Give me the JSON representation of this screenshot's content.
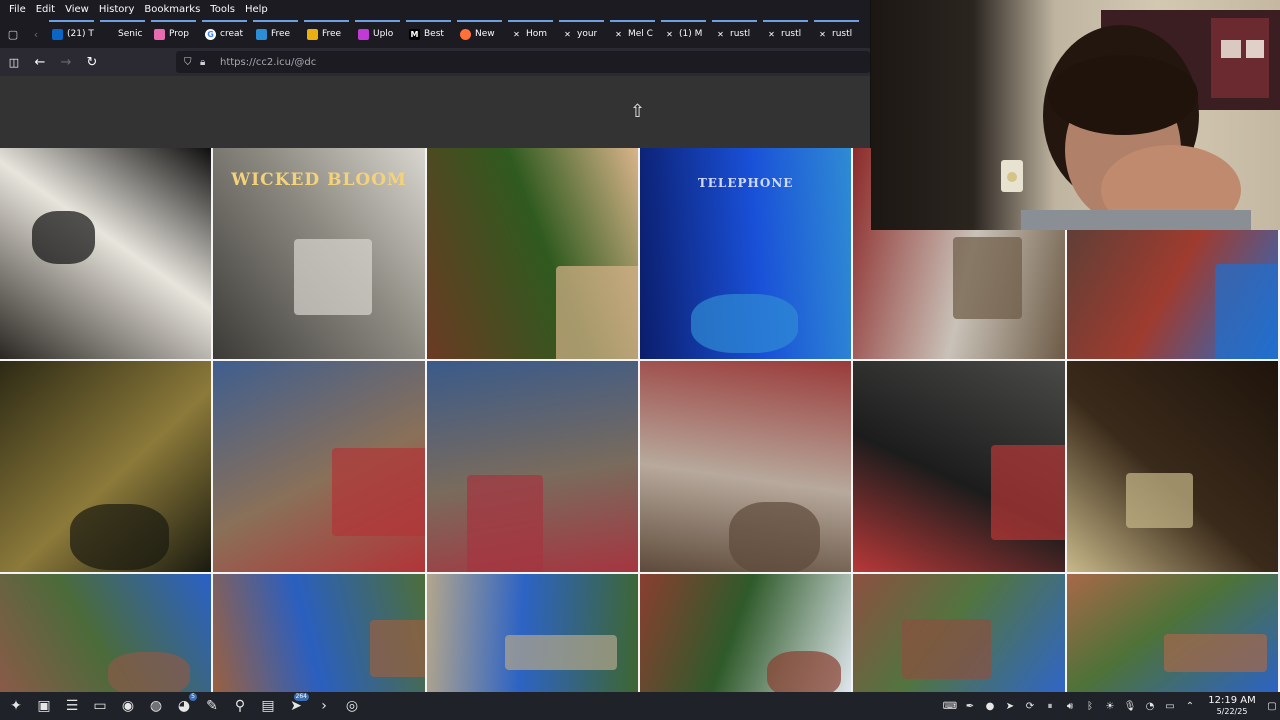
{
  "menu": [
    "File",
    "Edit",
    "View",
    "History",
    "Bookmarks",
    "Tools",
    "Help"
  ],
  "tabs": [
    {
      "label": "(21) T",
      "icon": "linkedin-icon",
      "color": "#0a66c2"
    },
    {
      "label": "Senic",
      "icon": "blank-page-icon",
      "color": "#3a3944"
    },
    {
      "label": "Prop",
      "icon": "ghost-icon",
      "color": "#e86ab0"
    },
    {
      "label": "creat",
      "icon": "google-icon",
      "color": "#ffffff"
    },
    {
      "label": "Free",
      "icon": "edge-icon",
      "color": "#2b8dd6"
    },
    {
      "label": "Free",
      "icon": "colorful-square-icon",
      "color": "#e9b10f"
    },
    {
      "label": "Uplo",
      "icon": "colorful-square-icon",
      "color": "#c23ad6"
    },
    {
      "label": "Best",
      "icon": "medium-icon",
      "color": "#000000"
    },
    {
      "label": "New",
      "icon": "firefox-icon",
      "color": "#ff7139"
    },
    {
      "label": "Hom",
      "icon": "x-icon",
      "color": "#000000"
    },
    {
      "label": "your",
      "icon": "x-icon",
      "color": "#000000"
    },
    {
      "label": "Mel C",
      "icon": "x-icon",
      "color": "#000000"
    },
    {
      "label": "(1) M",
      "icon": "x-icon",
      "color": "#000000"
    },
    {
      "label": "rustl",
      "icon": "x-icon",
      "color": "#000000"
    },
    {
      "label": "rustl",
      "icon": "x-icon",
      "color": "#000000"
    },
    {
      "label": "rustl",
      "icon": "x-icon",
      "color": "#000000"
    }
  ],
  "url": "https://cc2.icu/@dc",
  "photos": [
    {
      "name": "photo-vintage-camera",
      "colors": [
        "#2a2621",
        "#e8e5dd",
        "#0f0f0f"
      ]
    },
    {
      "name": "photo-wicked-bloom-storefront",
      "caption": "WICKED BLOOM",
      "colors": [
        "#3b3a36",
        "#8b8880",
        "#d9d6cf"
      ]
    },
    {
      "name": "photo-gingerbread-garden",
      "colors": [
        "#6b3a22",
        "#2f5a1f",
        "#d9b48a"
      ]
    },
    {
      "name": "photo-telephone-blue-light",
      "caption": "TELEPHONE",
      "colors": [
        "#0b1d6b",
        "#1950d8",
        "#2f8bd4"
      ]
    },
    {
      "name": "photo-construction-red-wall-1",
      "colors": [
        "#8c2a2a",
        "#c9c2b8",
        "#6c5a45"
      ]
    },
    {
      "name": "photo-construction-blue-tarp-1",
      "colors": [
        "#4a4039",
        "#9f3b2f",
        "#1f6fcf"
      ]
    },
    {
      "name": "photo-night-excavation-1",
      "colors": [
        "#2d2a15",
        "#8c7a3a",
        "#1a1a10"
      ]
    },
    {
      "name": "photo-blue-tarp-excavation-1",
      "colors": [
        "#3f5e8f",
        "#8a7058",
        "#b23438"
      ]
    },
    {
      "name": "photo-blue-tarp-excavation-2",
      "colors": [
        "#3a5a8a",
        "#7a6b5c",
        "#a53540"
      ]
    },
    {
      "name": "photo-excavation-red-wall",
      "colors": [
        "#9a3a3a",
        "#b7a99c",
        "#5e4a3a"
      ]
    },
    {
      "name": "photo-concrete-foundation",
      "colors": [
        "#4a4a48",
        "#1c1c1c",
        "#b83838"
      ]
    },
    {
      "name": "photo-night-foundation",
      "colors": [
        "#1f140c",
        "#3a2a1a",
        "#c8b98a"
      ]
    },
    {
      "name": "photo-backyard-tarp-1",
      "colors": [
        "#2a60c8",
        "#4b6b3a",
        "#8a5a48"
      ]
    },
    {
      "name": "photo-backyard-tarp-2",
      "colors": [
        "#4d6e3a",
        "#2a5fc0",
        "#9a6040"
      ]
    },
    {
      "name": "photo-backyard-tarp-3",
      "colors": [
        "#3e6630",
        "#2d63c4",
        "#b3a68c"
      ]
    },
    {
      "name": "photo-trees-brick-building",
      "colors": [
        "#dfe6ec",
        "#2f5a2a",
        "#8a3e30"
      ]
    },
    {
      "name": "photo-backyard-tarp-4",
      "colors": [
        "#2f66c8",
        "#52743f",
        "#8c5040"
      ]
    },
    {
      "name": "photo-backyard-tarp-5",
      "colors": [
        "#2c63c4",
        "#4e7238",
        "#a86848"
      ]
    }
  ],
  "taskbar": {
    "apps": [
      {
        "name": "app-launcher-icon",
        "glyph": "✦"
      },
      {
        "name": "package-store-icon",
        "glyph": "▣"
      },
      {
        "name": "settings-panel-icon",
        "glyph": "☰"
      },
      {
        "name": "file-manager-icon",
        "glyph": "▭"
      },
      {
        "name": "firefox-icon",
        "glyph": "◉"
      },
      {
        "name": "web-browser-icon",
        "glyph": "◍"
      },
      {
        "name": "discord-icon",
        "glyph": "◕",
        "badge": "5"
      },
      {
        "name": "text-editor-icon",
        "glyph": "✎"
      },
      {
        "name": "magnifier-icon",
        "glyph": "⚲"
      },
      {
        "name": "notes-icon",
        "glyph": "▤"
      },
      {
        "name": "telegram-icon",
        "glyph": "➤",
        "badge": "264"
      },
      {
        "name": "terminal-icon",
        "glyph": "›"
      },
      {
        "name": "obs-icon",
        "glyph": "◎"
      }
    ],
    "tray": [
      "keyboard-icon",
      "pen-icon",
      "obs-tray-icon",
      "telegram-tray-icon",
      "update-icon",
      "pause-icon",
      "volume-icon",
      "bluetooth-icon",
      "brightness-icon",
      "microphone-icon",
      "network-icon",
      "battery-icon",
      "chevron-up-icon"
    ],
    "time": "12:19 AM",
    "date": "5/22/25"
  }
}
